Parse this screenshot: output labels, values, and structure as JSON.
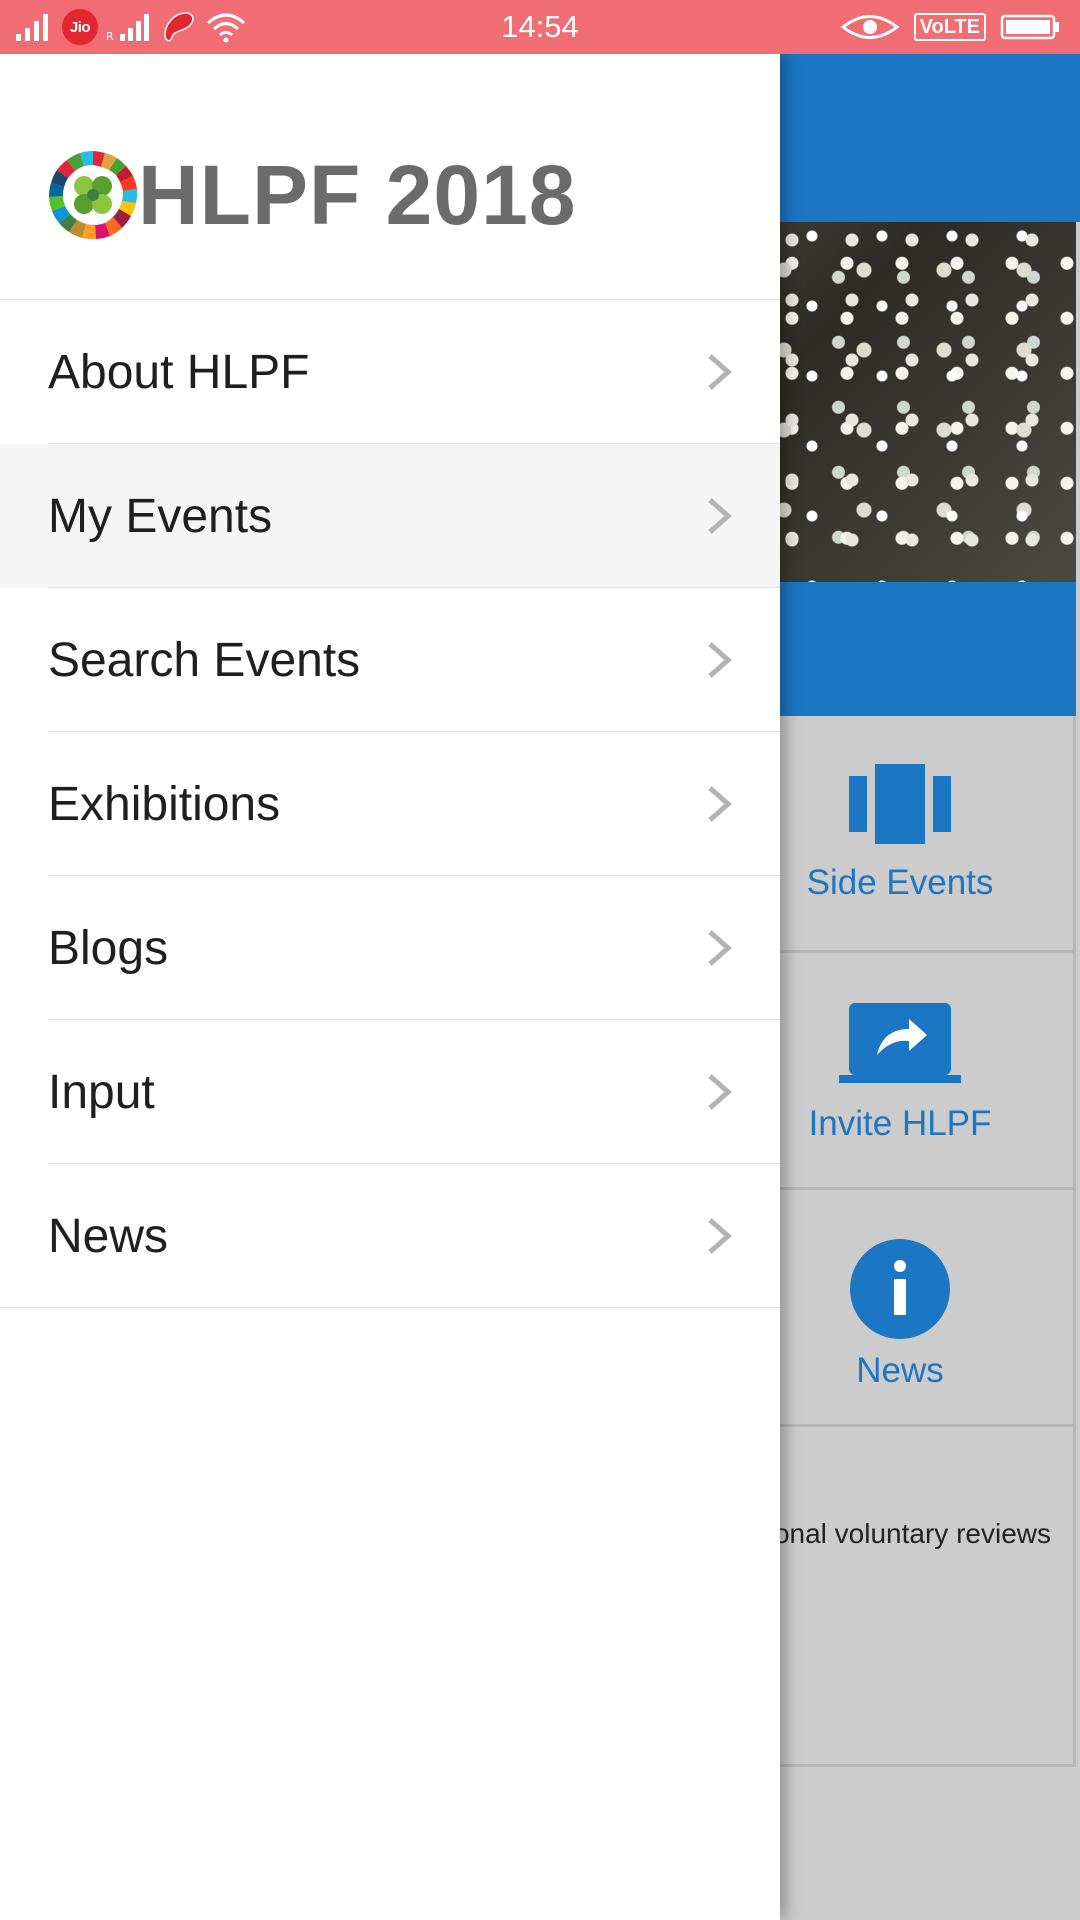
{
  "status_bar": {
    "time": "14:54",
    "carrier": "Jio",
    "network_badge": "VoLTE",
    "icons": [
      "signal-icon",
      "jio-icon",
      "signal-icon",
      "airtel-icon",
      "wifi-icon",
      "eye-icon",
      "volte-icon",
      "battery-icon"
    ]
  },
  "drawer": {
    "app_title": "HLPF 2018",
    "logo_icon": "sdg-wheel-logo",
    "items": [
      {
        "label": "About HLPF",
        "icon": "chevron-right-icon",
        "active": false
      },
      {
        "label": "My Events",
        "icon": "chevron-right-icon",
        "active": true
      },
      {
        "label": "Search Events",
        "icon": "chevron-right-icon",
        "active": false
      },
      {
        "label": "Exhibitions",
        "icon": "chevron-right-icon",
        "active": false
      },
      {
        "label": "Blogs",
        "icon": "chevron-right-icon",
        "active": false
      },
      {
        "label": "Input",
        "icon": "chevron-right-icon",
        "active": false
      },
      {
        "label": "News",
        "icon": "chevron-right-icon",
        "active": false
      }
    ]
  },
  "background_app": {
    "tiles": [
      {
        "label": "Side Events",
        "icon": "side-events-icon"
      },
      {
        "label": "Invite HLPF",
        "icon": "share-laptop-icon"
      },
      {
        "label": "News",
        "icon": "info-icon"
      }
    ],
    "partial_text": "onal voluntary reviews"
  },
  "colors": {
    "status_bar": "#f06e73",
    "primary_blue": "#1b76c4",
    "drawer_bg": "#ffffff",
    "active_item_bg": "#f5f5f5",
    "title_grey": "#6b6b6b"
  }
}
